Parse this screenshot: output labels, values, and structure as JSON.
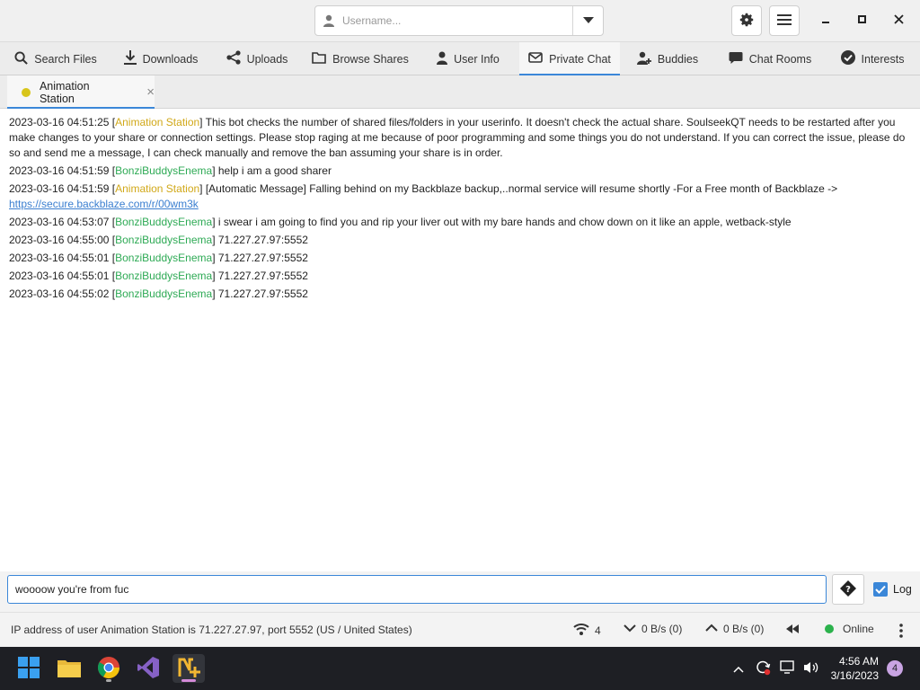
{
  "titlebar": {
    "username_placeholder": "Username...",
    "icons": [
      "user-icon",
      "chevron-down-icon",
      "gear-icon",
      "hamburger-menu-icon",
      "minimize-icon",
      "maximize-icon",
      "close-icon"
    ]
  },
  "main_tabs": [
    {
      "label": "Search Files",
      "icon": "search-icon",
      "active": false
    },
    {
      "label": "Downloads",
      "icon": "download-icon",
      "active": false
    },
    {
      "label": "Uploads",
      "icon": "share-icon",
      "active": false
    },
    {
      "label": "Browse Shares",
      "icon": "folder-icon",
      "active": false
    },
    {
      "label": "User Info",
      "icon": "user-icon",
      "active": false
    },
    {
      "label": "Private Chat",
      "icon": "envelope-icon",
      "active": true
    },
    {
      "label": "Buddies",
      "icon": "user-plus-icon",
      "active": false
    },
    {
      "label": "Chat Rooms",
      "icon": "chat-bubble-icon",
      "active": false
    },
    {
      "label": "Interests",
      "icon": "check-circle-icon",
      "active": false
    }
  ],
  "chat_tab": {
    "label": "Animation Station",
    "close": "×",
    "status_color": "#d8c51a"
  },
  "messages": [
    {
      "time": "2023-03-16 04:51:25",
      "user": "Animation Station",
      "user_type": "anim",
      "text": "This bot checks the number of shared files/folders in your userinfo. It doesn't check the actual share. SoulseekQT needs to be restarted after you make changes to your share or connection settings. Please stop raging at me because of poor programming and some things you do not understand. If you can correct the issue, please do so and send me a message, I can check manually and remove the ban assuming your share is in order."
    },
    {
      "time": "2023-03-16 04:51:59",
      "user": "BonziBuddysEnema",
      "user_type": "bonzi",
      "text": "help i am a good sharer"
    },
    {
      "time": "2023-03-16 04:51:59",
      "user": "Animation Station",
      "user_type": "anim",
      "text": "[Automatic Message] Falling behind on my Backblaze backup,..normal service will resume shortly -For a Free month of Backblaze -> ",
      "link": "https://secure.backblaze.com/r/00wm3k"
    },
    {
      "time": "2023-03-16 04:53:07",
      "user": "BonziBuddysEnema",
      "user_type": "bonzi",
      "text": "i swear i am going to find you and rip your liver out with my bare hands and chow down on it like an apple, wetback-style"
    },
    {
      "time": "2023-03-16 04:55:00",
      "user": "BonziBuddysEnema",
      "user_type": "bonzi",
      "text": "71.227.27.97:5552"
    },
    {
      "time": "2023-03-16 04:55:01",
      "user": "BonziBuddysEnema",
      "user_type": "bonzi",
      "text": "71.227.27.97:5552"
    },
    {
      "time": "2023-03-16 04:55:01",
      "user": "BonziBuddysEnema",
      "user_type": "bonzi",
      "text": "71.227.27.97:5552"
    },
    {
      "time": "2023-03-16 04:55:02",
      "user": "BonziBuddysEnema",
      "user_type": "bonzi",
      "text": "71.227.27.97:5552"
    }
  ],
  "input": {
    "value": "woooow you're from fuc",
    "log_label": "Log",
    "log_checked": true
  },
  "status": {
    "text": "IP address of user Animation Station is 71.227.27.97, port 5552 (US / United States)",
    "connections": "4",
    "download_rate": "0 B/s (0)",
    "upload_rate": "0 B/s (0)",
    "online": "Online"
  },
  "taskbar": {
    "apps": [
      "windows-start-icon",
      "file-explorer-icon",
      "chrome-icon",
      "visual-studio-icon",
      "nicotine-plus-icon"
    ],
    "time": "4:56 AM",
    "date": "3/16/2023",
    "notifications": "4"
  },
  "colors": {
    "accent": "#3b87d8",
    "anim_user": "#d1a818",
    "bonzi_user": "#2eaa55",
    "online": "#2bb24c"
  }
}
